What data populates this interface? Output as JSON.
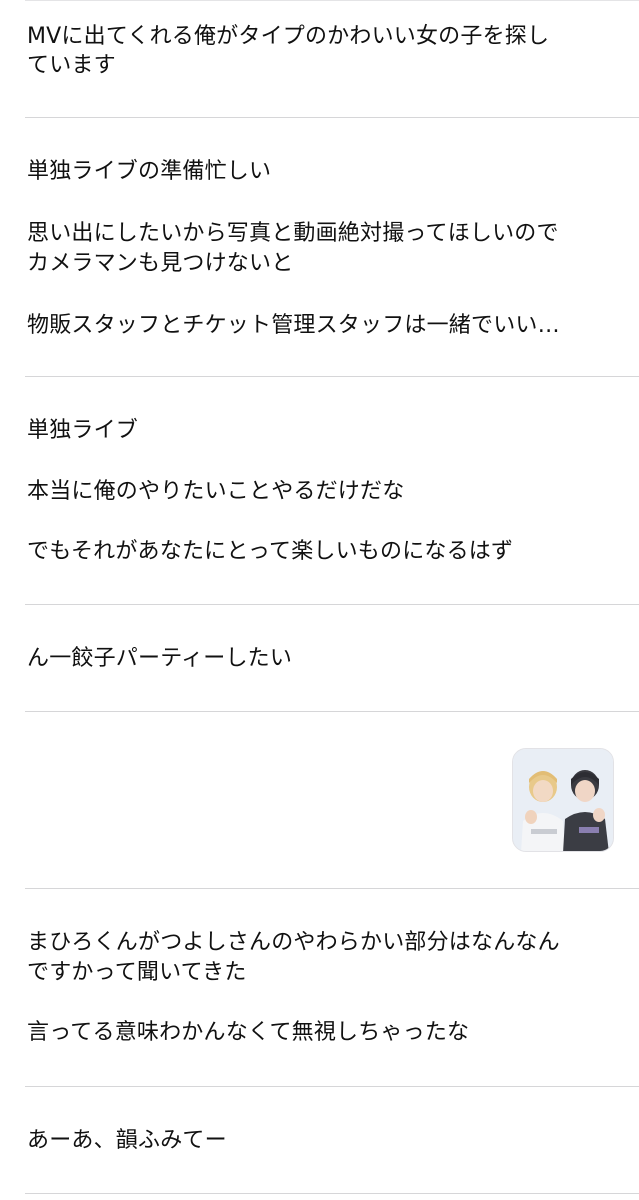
{
  "notes": [
    {
      "lines": [
        "MVに出てくれる俺がタイプのかわいい女の子を探し",
        "ています"
      ]
    },
    {
      "lines": [
        "単独ライブの準備忙しい",
        "思い出にしたいから写真と動画絶対撮ってほしいので",
        "カメラマンも見つけないと",
        "物販スタッフとチケット管理スタッフは一緒でいい…"
      ]
    },
    {
      "lines": [
        "単独ライブ",
        "本当に俺のやりたいことやるだけだな",
        "でもそれがあなたにとって楽しいものになるはず"
      ]
    },
    {
      "lines": [
        "ん一餃子パーティーしたい"
      ]
    },
    {
      "lines": [],
      "thumbnail": "photo-thumbnail"
    },
    {
      "lines": [
        "まひろくんがつよしさんのやわらかい部分はなんなん",
        "ですかって聞いてきた",
        "言ってる意味わかんなくて無視しちゃったな"
      ]
    },
    {
      "lines": [
        "あーあ、韻ふみてー"
      ]
    }
  ],
  "colors": {
    "text": "#111111",
    "separator": "#d6d6d8",
    "background": "#ffffff"
  }
}
